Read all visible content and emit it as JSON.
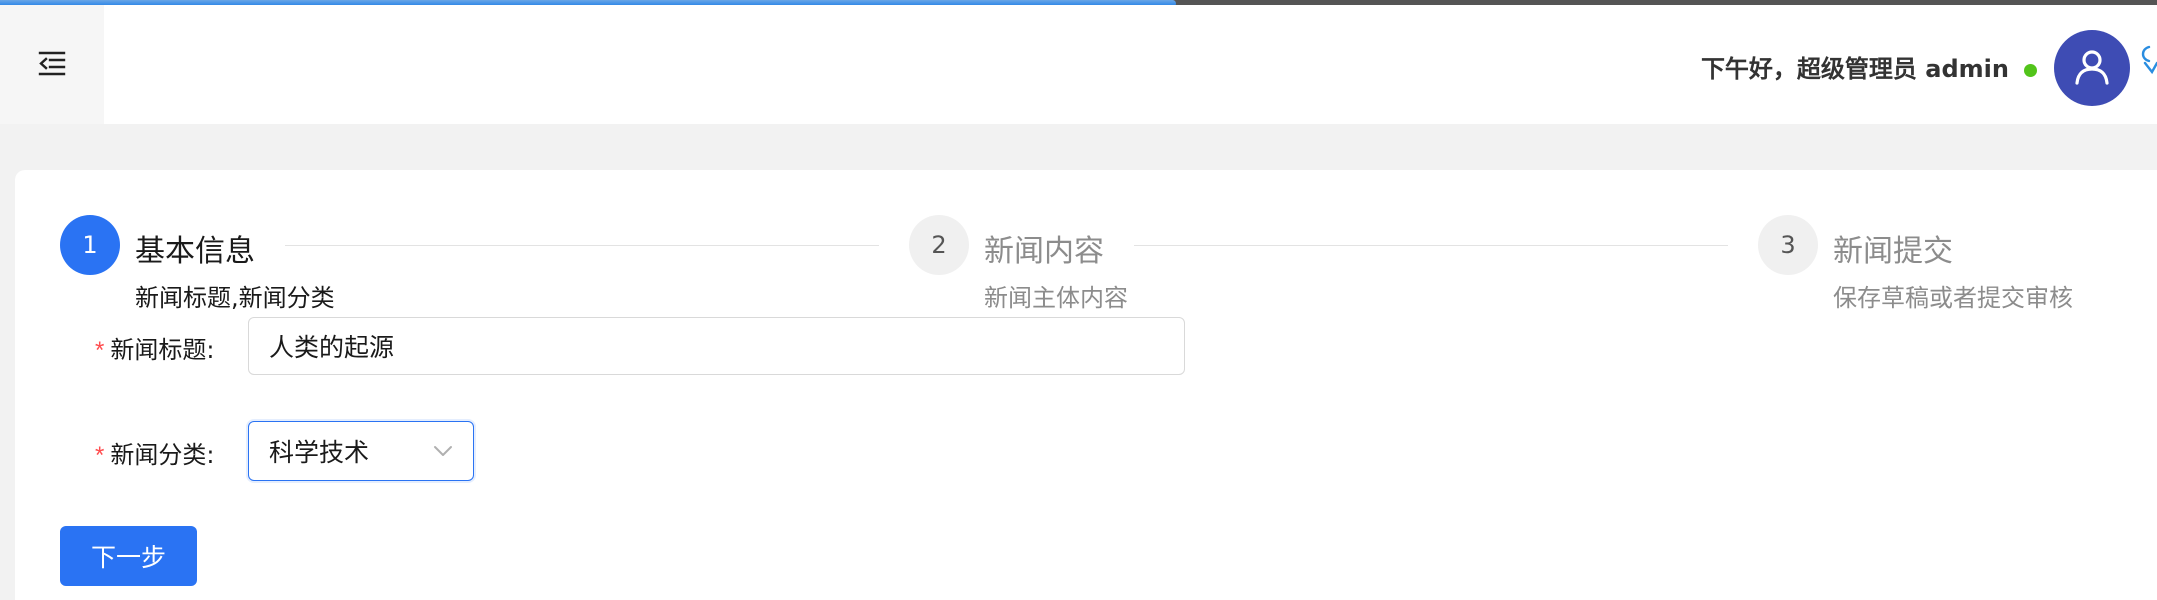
{
  "loading_progress": 0.545,
  "header": {
    "menu_icon": "indent-menu-icon",
    "greeting": "下午好，超级管理员 admin",
    "status_color": "#52c41a",
    "avatar_icon": "user-icon",
    "avatar_color": "#3e4cb4"
  },
  "steps": [
    {
      "number": "1",
      "title": "基本信息",
      "description": "新闻标题,新闻分类",
      "status": "active"
    },
    {
      "number": "2",
      "title": "新闻内容",
      "description": "新闻主体内容",
      "status": "wait"
    },
    {
      "number": "3",
      "title": "新闻提交",
      "description": "保存草稿或者提交审核",
      "status": "wait"
    }
  ],
  "form": {
    "title_label": "新闻标题:",
    "title_value": "人类的起源",
    "category_label": "新闻分类:",
    "category_value": "科学技术",
    "required_mark": "*"
  },
  "next_button": "下一步",
  "colors": {
    "primary": "#2a73f3",
    "required": "#ff4d4f"
  }
}
